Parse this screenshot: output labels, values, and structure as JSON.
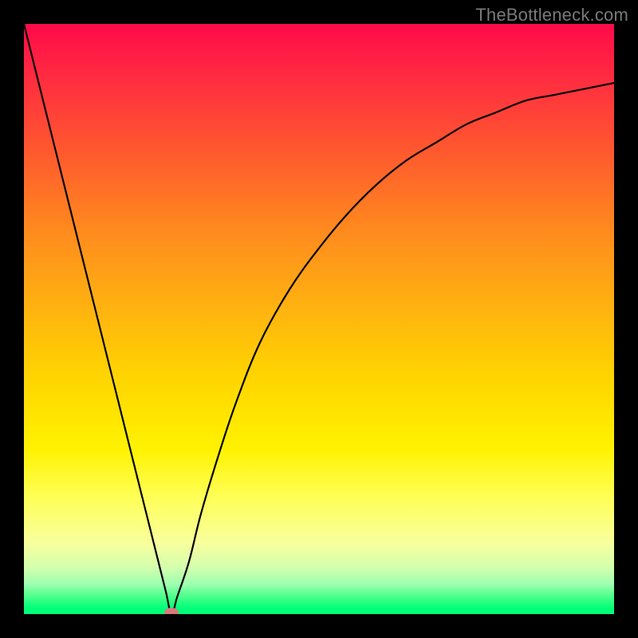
{
  "watermark": {
    "text": "TheBottleneck.com"
  },
  "colors": {
    "frame": "#000000",
    "curve": "#000000",
    "marker": "#d87a7a",
    "gradient_top": "#ff0a4a",
    "gradient_bottom": "#00ff78"
  },
  "chart_data": {
    "type": "line",
    "title": "",
    "xlabel": "",
    "ylabel": "",
    "xlim": [
      0,
      100
    ],
    "ylim": [
      0,
      100
    ],
    "grid": false,
    "legend": false,
    "series": [
      {
        "name": "bottleneck-curve",
        "x": [
          0,
          5,
          10,
          15,
          20,
          22,
          24,
          25,
          26,
          28,
          30,
          33,
          36,
          40,
          45,
          50,
          55,
          60,
          65,
          70,
          75,
          80,
          85,
          90,
          95,
          100
        ],
        "y": [
          100,
          80,
          60,
          40,
          20,
          12,
          4,
          0,
          3,
          9,
          17,
          27,
          36,
          46,
          55,
          62,
          68,
          73,
          77,
          80,
          83,
          85,
          87,
          88,
          89,
          90
        ]
      }
    ],
    "annotations": [
      {
        "name": "min-marker",
        "x": 25,
        "y": 0,
        "shape": "ellipse",
        "color": "#d87a7a"
      }
    ],
    "background": {
      "type": "vertical-gradient",
      "stops": [
        {
          "pos": 0.0,
          "color": "#ff0a4a"
        },
        {
          "pos": 0.35,
          "color": "#ff8a1e"
        },
        {
          "pos": 0.6,
          "color": "#ffd500"
        },
        {
          "pos": 0.8,
          "color": "#ffff55"
        },
        {
          "pos": 0.95,
          "color": "#9cffb0"
        },
        {
          "pos": 1.0,
          "color": "#00ff78"
        }
      ]
    }
  }
}
